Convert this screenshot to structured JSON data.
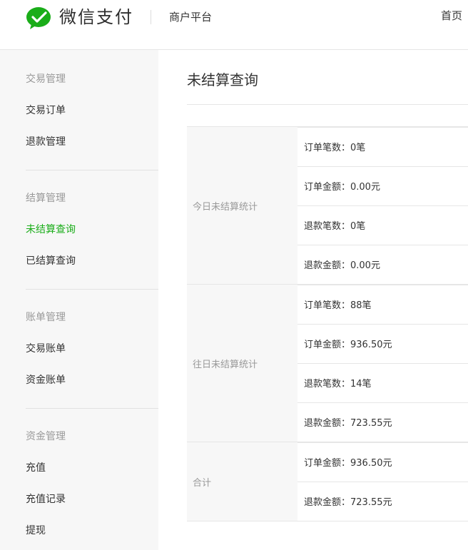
{
  "header": {
    "brand": "微信支付",
    "platform": "商户平台",
    "home": "首页",
    "logo_icon": "wechat-logo-icon",
    "brand_color": "#1aad19"
  },
  "sidebar": {
    "groups": [
      {
        "title": "交易管理",
        "items": [
          "交易订单",
          "退款管理"
        ]
      },
      {
        "title": "结算管理",
        "items": [
          "未结算查询",
          "已结算查询"
        ]
      },
      {
        "title": "账单管理",
        "items": [
          "交易账单",
          "资金账单"
        ]
      },
      {
        "title": "资金管理",
        "items": [
          "充值",
          "充值记录",
          "提现"
        ]
      }
    ],
    "active_item": "未结算查询"
  },
  "main": {
    "title": "未结算查询",
    "groups": [
      {
        "label": "今日未结算统计",
        "rows": [
          "订单笔数：0笔",
          "订单金额：0.00元",
          "退款笔数：0笔",
          "退款金额：0.00元"
        ]
      },
      {
        "label": "往日未结算统计",
        "rows": [
          "订单笔数：88笔",
          "订单金额：936.50元",
          "退款笔数：14笔",
          "退款金额：723.55元"
        ]
      },
      {
        "label": "合计",
        "rows": [
          "订单金额：936.50元",
          "退款金额：723.55元"
        ]
      }
    ]
  }
}
